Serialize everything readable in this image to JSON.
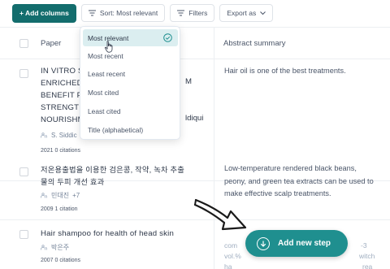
{
  "toolbar": {
    "add_columns": "+ Add columns",
    "sort_label": "Sort: Most relevant",
    "filters_label": "Filters",
    "export_label": "Export as"
  },
  "columns": {
    "paper": "Paper",
    "abstract": "Abstract summary"
  },
  "sort_menu": {
    "options": [
      "Most relevant",
      "Most recent",
      "Least recent",
      "Most cited",
      "Least cited",
      "Title (alphabetical)"
    ],
    "selected": "Most relevant"
  },
  "rows": [
    {
      "title_lines": [
        "IN VITRO S",
        "ENRICHED",
        "BENEFIT FO",
        "STRENGTH",
        "NOURISHM"
      ],
      "title_right_fragments": [
        "M",
        "",
        "",
        "ldiqui"
      ],
      "author": "S. Siddic",
      "citations": "2021 0 citations",
      "abstract": "Hair oil is one of the best treatments."
    },
    {
      "title_lines": [
        "저온용출법을 이용한 검은콩, 작약, 녹차 추출",
        "물의 두피 개선 효과"
      ],
      "author": "민대진",
      "author_extra": "+7",
      "citations": "2009 1 citation",
      "abstract": "Low-temperature rendered black beans, peony, and green tea extracts can be used to make effective scalp treatments."
    },
    {
      "title_lines": [
        "Hair shampoo for health of head skin"
      ],
      "author": "박은주",
      "citations": "2007 0 citations",
      "abstract_fragments": [
        "com",
        "-3",
        "vol.%",
        "witch",
        "ha",
        "rea"
      ]
    }
  ],
  "add_step": "Add new step",
  "colors": {
    "primary": "#136d6d",
    "add_step": "#1f8f8f",
    "selected_bg": "#dbeef0"
  }
}
